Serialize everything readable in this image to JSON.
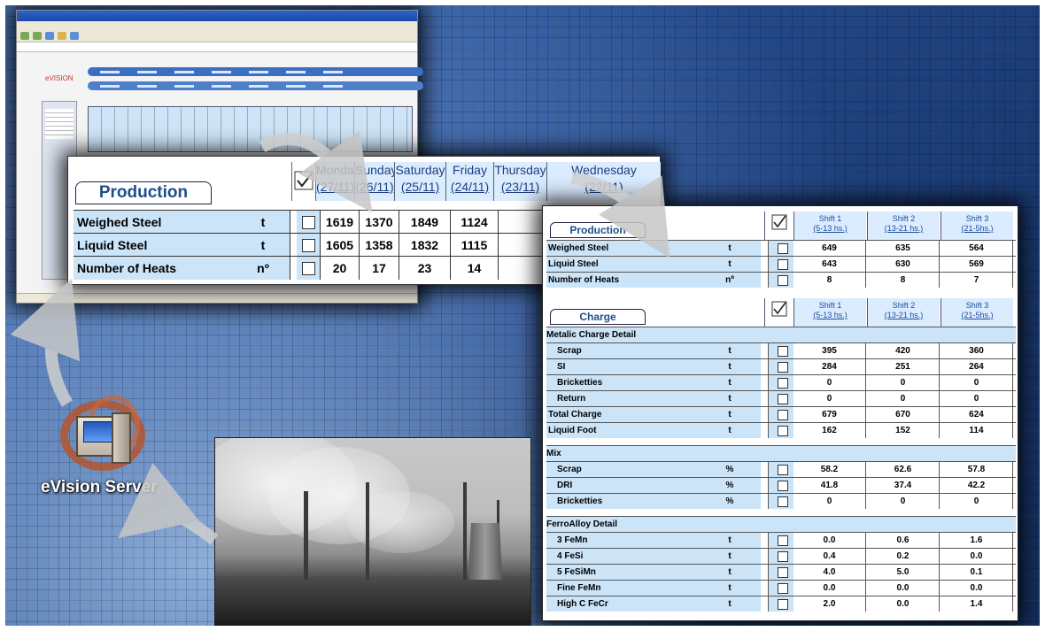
{
  "production": {
    "title": "Production",
    "days": [
      {
        "name": "Monday",
        "date": "(27/11)"
      },
      {
        "name": "Sunday",
        "date": "(26/11)"
      },
      {
        "name": "Saturday",
        "date": "(25/11)"
      },
      {
        "name": "Friday",
        "date": "(24/11)"
      },
      {
        "name": "Thursday",
        "date": "(23/11)"
      },
      {
        "name": "Wednesday",
        "date": "(22/11)"
      }
    ],
    "rows": [
      {
        "label": "Weighed Steel",
        "unit": "t",
        "values": [
          "1619",
          "1370",
          "1849",
          "1124"
        ]
      },
      {
        "label": "Liquid Steel",
        "unit": "t",
        "values": [
          "1605",
          "1358",
          "1832",
          "1115"
        ]
      },
      {
        "label": "Number of Heats",
        "unit": "nº",
        "values": [
          "20",
          "17",
          "23",
          "14"
        ]
      }
    ]
  },
  "detail": {
    "shifts": [
      {
        "name": "Shift 1",
        "hours": "(5-13 hs.)"
      },
      {
        "name": "Shift 2",
        "hours": "(13-21 hs.)"
      },
      {
        "name": "Shift 3",
        "hours": "(21-5hs.)"
      }
    ],
    "production_title": "Production",
    "production_rows": [
      {
        "label": "Weighed Steel",
        "unit": "t",
        "values": [
          "649",
          "635",
          "564"
        ]
      },
      {
        "label": "Liquid Steel",
        "unit": "t",
        "values": [
          "643",
          "630",
          "569"
        ]
      },
      {
        "label": "Number of Heats",
        "unit": "nº",
        "values": [
          "8",
          "8",
          "7"
        ]
      }
    ],
    "charge_title": "Charge",
    "metallic_header": "Metalic Charge Detail",
    "metallic_rows": [
      {
        "label": "Scrap",
        "unit": "t",
        "values": [
          "395",
          "420",
          "360"
        ]
      },
      {
        "label": "SI",
        "unit": "t",
        "values": [
          "284",
          "251",
          "264"
        ]
      },
      {
        "label": "Bricketties",
        "unit": "t",
        "values": [
          "0",
          "0",
          "0"
        ]
      },
      {
        "label": "Return",
        "unit": "t",
        "values": [
          "0",
          "0",
          "0"
        ]
      }
    ],
    "total_rows": [
      {
        "label": "Total Charge",
        "unit": "t",
        "values": [
          "679",
          "670",
          "624"
        ]
      },
      {
        "label": "Liquid Foot",
        "unit": "t",
        "values": [
          "162",
          "152",
          "114"
        ]
      }
    ],
    "mix_header": "Mix",
    "mix_rows": [
      {
        "label": "Scrap",
        "unit": "%",
        "values": [
          "58.2",
          "62.6",
          "57.8"
        ]
      },
      {
        "label": "DRI",
        "unit": "%",
        "values": [
          "41.8",
          "37.4",
          "42.2"
        ]
      },
      {
        "label": "Bricketties",
        "unit": "%",
        "values": [
          "0",
          "0",
          "0"
        ]
      }
    ],
    "ferro_header": "FerroAlloy Detail",
    "ferro_rows": [
      {
        "label": "3 FeMn",
        "unit": "t",
        "values": [
          "0.0",
          "0.6",
          "1.6"
        ]
      },
      {
        "label": "4 FeSi",
        "unit": "t",
        "values": [
          "0.4",
          "0.2",
          "0.0"
        ]
      },
      {
        "label": "5 FeSiMn",
        "unit": "t",
        "values": [
          "4.0",
          "5.0",
          "0.1"
        ]
      },
      {
        "label": "Fine FeMn",
        "unit": "t",
        "values": [
          "0.0",
          "0.0",
          "0.0"
        ]
      },
      {
        "label": "High C FeCr",
        "unit": "t",
        "values": [
          "2.0",
          "0.0",
          "1.4"
        ]
      }
    ]
  },
  "server": {
    "label": "eVision Server"
  },
  "browser": {
    "logo": "eVISION"
  },
  "colors": {
    "cell_blue": "#cbe4f8",
    "header_blue": "#dcecff",
    "title_blue": "#1f4e8c",
    "bg_blue": "#284f92"
  }
}
